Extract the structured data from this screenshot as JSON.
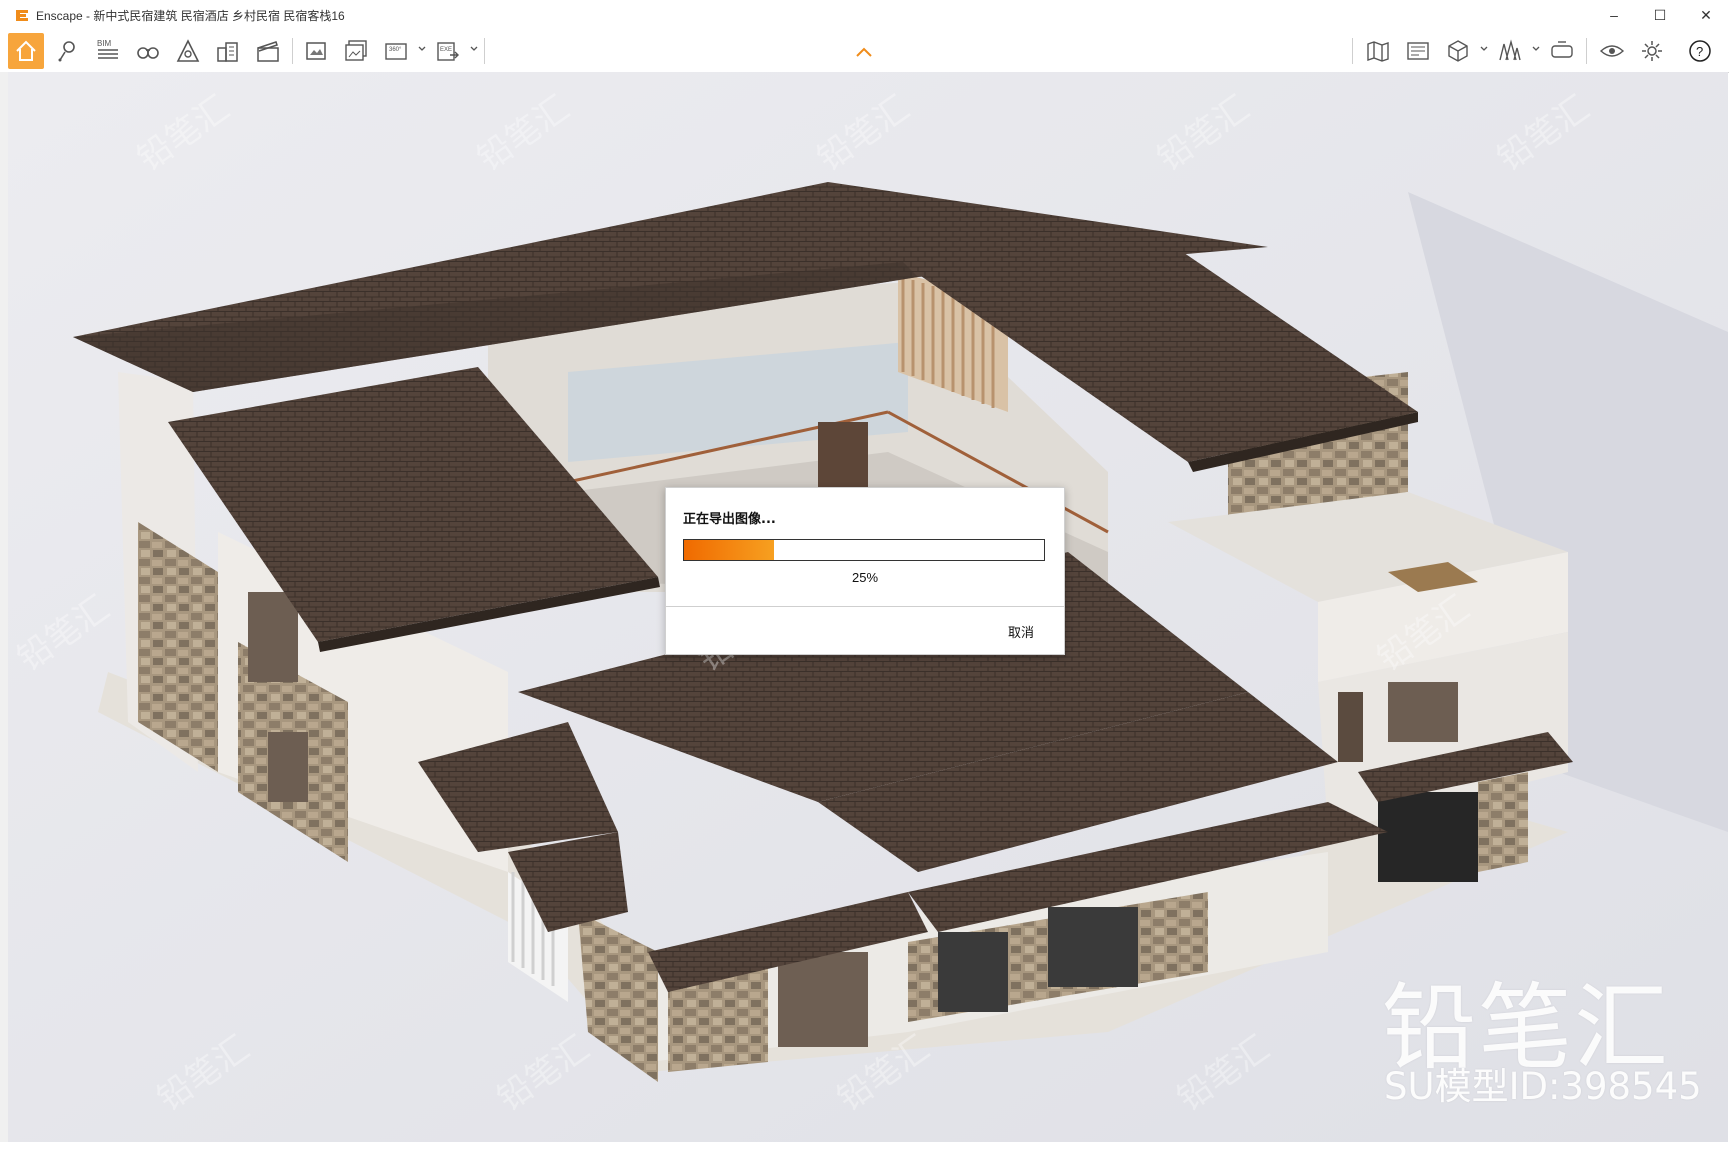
{
  "window": {
    "title": "Enscape - 新中式民宿建筑 民宿酒店 乡村民宿 民宿客栈16",
    "controls": {
      "minimize": "–",
      "maximize": "☐",
      "close": "✕"
    }
  },
  "toolbar": {
    "left_icons": [
      "home-icon",
      "map-pin-icon",
      "bim-icon",
      "binoculars-icon",
      "visual-settings-icon",
      "buildings-icon",
      "clapperboard-icon",
      "screenshot-icon",
      "batch-render-icon",
      "panorama-360-icon",
      "export-exe-icon"
    ],
    "bim_label": "BIM",
    "pano_label": "360°",
    "exe_label": "EXE",
    "right_icons": [
      "map-icon",
      "view-management-icon",
      "asset-library-icon",
      "site-context-icon",
      "vr-headset-icon",
      "eye-icon",
      "settings-gear-icon",
      "help-icon"
    ],
    "help_label": "?"
  },
  "dialog": {
    "title": "正在导出图像...",
    "progress_percent": 25,
    "progress_label": "25%",
    "cancel_label": "取消"
  },
  "watermark": {
    "brand": "铅笔汇",
    "model_id": "SU模型ID:398545"
  },
  "colors": {
    "accent": "#f7a53c",
    "progress": "#f06a00",
    "roof": "#4e3f37",
    "wall": "#f2f0ee",
    "stone": "#9b8b78"
  }
}
